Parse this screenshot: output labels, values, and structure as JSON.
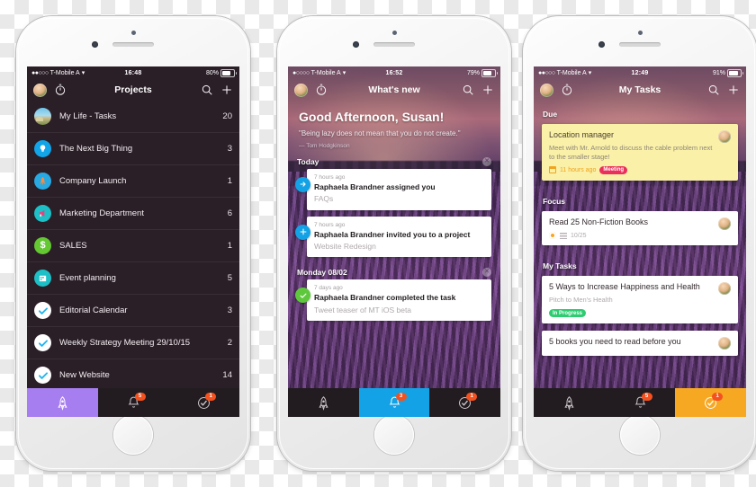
{
  "phones": [
    {
      "id": "projects",
      "status": {
        "signal_dots": "●●○○○",
        "carrier": "T-Mobile A",
        "wifi": "▾",
        "time": "16:48",
        "battery_text": "80%",
        "battery_pct": 80
      },
      "nav": {
        "title": "Projects",
        "timer_icon": "timer-icon",
        "search_icon": "search-icon",
        "add_icon": "plus-icon",
        "avatar": "user-avatar"
      },
      "projects": [
        {
          "name": "My Life - Tasks",
          "count": "20",
          "icon": "photo-icon",
          "icon_class": "ic-photo"
        },
        {
          "name": "The Next Big Thing",
          "count": "3",
          "icon": "lightbulb-icon",
          "icon_class": "ic-bulb"
        },
        {
          "name": "Company Launch",
          "count": "1",
          "icon": "rocket-icon",
          "icon_class": "ic-rocket"
        },
        {
          "name": "Marketing Department",
          "count": "6",
          "icon": "megaphone-icon",
          "icon_class": "ic-mega"
        },
        {
          "name": "SALES",
          "count": "1",
          "icon": "dollar-icon",
          "icon_class": "ic-dollar"
        },
        {
          "name": "Event planning",
          "count": "5",
          "icon": "calendar-icon",
          "icon_class": "ic-cal"
        },
        {
          "name": "Editorial Calendar",
          "count": "3",
          "icon": "check-icon",
          "icon_class": "ic-check"
        },
        {
          "name": "Weekly Strategy Meeting 29/10/15",
          "count": "2",
          "icon": "check-icon",
          "icon_class": "ic-check"
        },
        {
          "name": "New Website",
          "count": "14",
          "icon": "check-icon",
          "icon_class": "ic-check"
        }
      ],
      "tabs": [
        {
          "icon": "rocket-icon",
          "active": true,
          "active_class": "active-purple",
          "badge": ""
        },
        {
          "icon": "bell-icon",
          "active": false,
          "active_class": "",
          "badge": "5"
        },
        {
          "icon": "check-circle-icon",
          "active": false,
          "active_class": "",
          "badge": "1"
        }
      ]
    },
    {
      "id": "whats-new",
      "status": {
        "signal_dots": "●○○○○",
        "carrier": "T-Mobile A",
        "wifi": "▾",
        "time": "16:52",
        "battery_text": "79%",
        "battery_pct": 79
      },
      "nav": {
        "title": "What's new",
        "timer_icon": "timer-icon",
        "search_icon": "search-icon",
        "add_icon": "plus-icon",
        "avatar": "user-avatar"
      },
      "greeting": {
        "title": "Good Afternoon, Susan!",
        "quote": "\"Being lazy does not mean that you do not create.\"",
        "author": "— Tom Hodgkinson"
      },
      "sections": [
        {
          "label": "Today",
          "items": [
            {
              "time": "7 hours ago",
              "action": "Raphaela Brandner assigned you",
              "subject": "FAQs",
              "bullet": "arrow-right-icon",
              "bullet_class": "b-blue"
            },
            {
              "time": "7 hours ago",
              "action": "Raphaela Brandner invited you to a project",
              "subject": "Website Redesign",
              "bullet": "plus-icon",
              "bullet_class": "b-blue"
            }
          ]
        },
        {
          "label": "Monday 08/02",
          "items": [
            {
              "time": "7 days ago",
              "action": "Raphaela Brandner completed the task",
              "subject": "Tweet teaser of MT iOS beta",
              "bullet": "check-icon",
              "bullet_class": "b-green"
            }
          ]
        }
      ],
      "tabs": [
        {
          "icon": "rocket-icon",
          "active": false,
          "active_class": "",
          "badge": ""
        },
        {
          "icon": "bell-icon",
          "active": true,
          "active_class": "active-blue",
          "badge": "3"
        },
        {
          "icon": "check-circle-icon",
          "active": false,
          "active_class": "",
          "badge": "1"
        }
      ]
    },
    {
      "id": "my-tasks",
      "status": {
        "signal_dots": "●●○○○",
        "carrier": "T-Mobile A",
        "wifi": "▾",
        "time": "12:49",
        "battery_text": "91%",
        "battery_pct": 91
      },
      "nav": {
        "title": "My Tasks",
        "timer_icon": "timer-icon",
        "search_icon": "search-icon",
        "add_icon": "plus-icon",
        "avatar": "user-avatar"
      },
      "task_sections": [
        {
          "label": "Due",
          "tasks": [
            {
              "title": "Location manager",
              "desc": "Meet with Mr. Arnold to discuss the cable problem next to the smaller stage!",
              "when": "11 hours ago",
              "chip": "Meeting",
              "chip_class": "meeting",
              "style": "due",
              "progress": ""
            }
          ]
        },
        {
          "label": "Focus",
          "tasks": [
            {
              "title": "Read 25 Non-Fiction Books",
              "desc": "",
              "when": "",
              "chip": "",
              "chip_class": "",
              "style": "white",
              "progress": "10/25"
            }
          ]
        },
        {
          "label": "My Tasks",
          "tasks": [
            {
              "title": "5 Ways to Increase Happiness and Health",
              "desc": "Pitch to Men's Health",
              "when": "",
              "chip": "In Progress",
              "chip_class": "inprog",
              "style": "white",
              "progress": ""
            },
            {
              "title": "5 books you need to read before you",
              "desc": "",
              "when": "",
              "chip": "",
              "chip_class": "",
              "style": "white",
              "progress": ""
            }
          ]
        }
      ],
      "tabs": [
        {
          "icon": "rocket-icon",
          "active": false,
          "active_class": "",
          "badge": ""
        },
        {
          "icon": "bell-icon",
          "active": false,
          "active_class": "",
          "badge": "5"
        },
        {
          "icon": "check-circle-icon",
          "active": true,
          "active_class": "active-orange",
          "badge": "1"
        }
      ]
    }
  ],
  "colors": {
    "purple_accent": "#a77ef0",
    "blue_accent": "#13a2e6",
    "orange_accent": "#f7a823",
    "badge_red": "#f4511e",
    "due_yellow": "#faf0a8",
    "chip_meeting": "#ea2f5c",
    "chip_inprogress": "#2ecc71"
  }
}
